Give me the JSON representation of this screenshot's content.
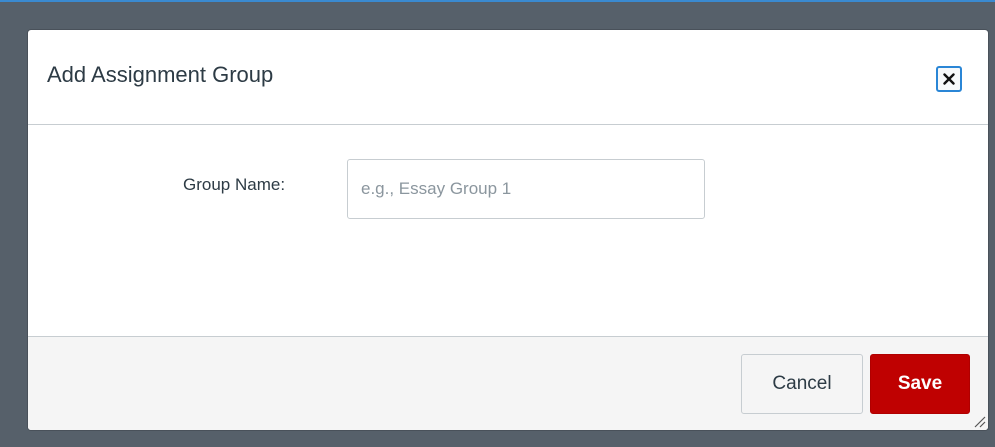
{
  "dialog": {
    "title": "Add Assignment Group",
    "close_icon": "close-icon"
  },
  "form": {
    "group_name_label": "Group Name:",
    "group_name_value": "",
    "group_name_placeholder": "e.g., Essay Group 1"
  },
  "footer": {
    "cancel_label": "Cancel",
    "save_label": "Save",
    "resize_icon": "resize-grip-icon"
  },
  "colors": {
    "overlay": "#56606a",
    "primary_button": "#bf0101",
    "focus_ring": "#2a86d6",
    "text": "#2d3b45"
  }
}
